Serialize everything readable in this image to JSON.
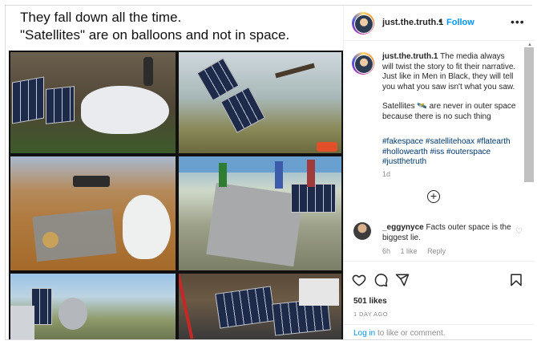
{
  "image": {
    "caption_lines": [
      "They fall down all the time.",
      "\"Satellites\" are on balloons and not in space."
    ]
  },
  "header": {
    "username": "just.the.truth.1",
    "separator": "•",
    "follow_label": "Follow",
    "more_label": "•••"
  },
  "post_comment": {
    "username": "just.the.truth.1",
    "paragraph1": "The media always will twist the story to fit their narrative. Just like in Men in Black, they will tell you what you saw isn't what you saw.",
    "paragraph2_before": "Satellites",
    "paragraph2_emoji": "🛰️",
    "paragraph2_after": "are never in outer space because there is no such thing",
    "hashtags": "#fakespace #satellitehoax #flatearth #hollowearth #iss #outerspace #justthetruth",
    "time": "1d"
  },
  "load_more_label": "+",
  "reply_comment": {
    "username": "_eggynyce",
    "text": "Facts outer space is the biggest lie.",
    "time": "6h",
    "likes": "1 like",
    "reply_label": "Reply"
  },
  "actions": {
    "likes": "501 likes",
    "date": "1 DAY AGO",
    "login_link": "Log in",
    "login_rest": "to like or comment."
  },
  "icons": [
    "heart-icon",
    "comment-icon",
    "share-icon",
    "bookmark-icon",
    "add-comment-icon",
    "more-options-icon"
  ],
  "colors": {
    "link_blue": "#0095f6",
    "hashtag": "#00376b",
    "muted": "#8e8e8e",
    "text": "#262626"
  }
}
